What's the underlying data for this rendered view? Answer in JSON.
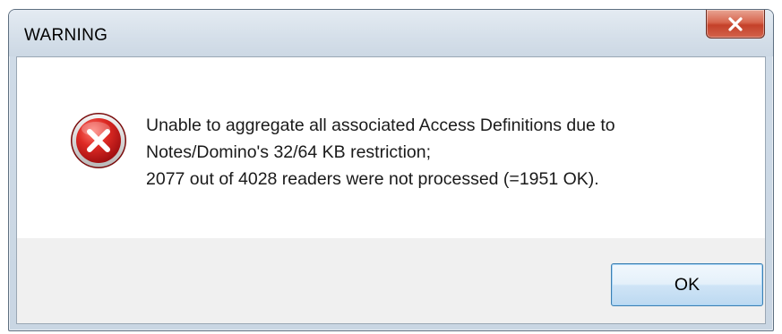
{
  "dialog": {
    "title": "WARNING",
    "close_symbol": "x",
    "icon": "error-icon",
    "message_lines": [
      "Unable to aggregate all associated Access Definitions due to",
      "Notes/Domino's 32/64 KB restriction;",
      "2077 out of 4028 readers were not processed (=1951 OK)."
    ],
    "ok_label": "OK"
  },
  "colors": {
    "error_red": "#c8171c",
    "close_red": "#c4412a",
    "button_border": "#3c7fb1",
    "footer_bg": "#f0f0f0"
  }
}
